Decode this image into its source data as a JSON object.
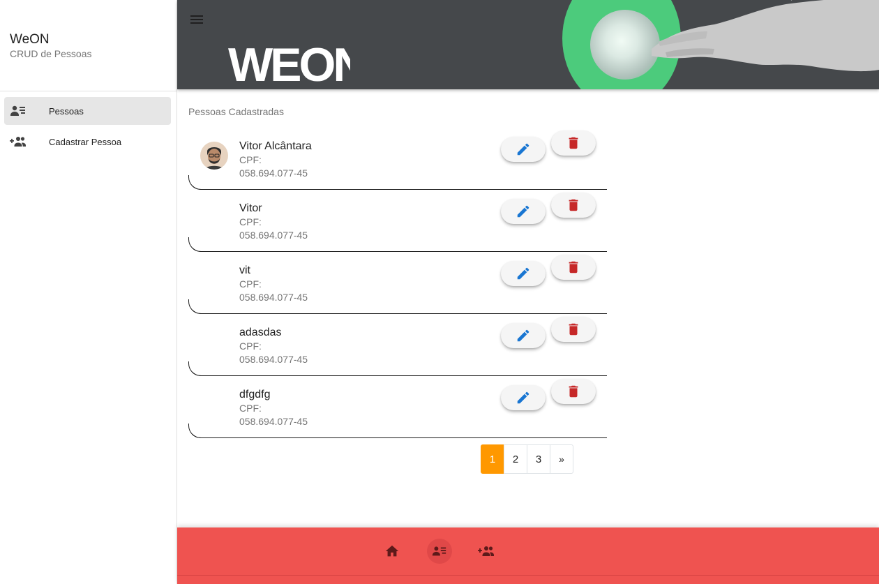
{
  "sidebar": {
    "title": "WeON",
    "subtitle": "CRUD de Pessoas",
    "items": [
      {
        "label": "Pessoas",
        "icon": "person-list-icon",
        "active": true
      },
      {
        "label": "Cadastrar Pessoa",
        "icon": "add-group-icon",
        "active": false
      }
    ]
  },
  "header": {
    "menu_icon": "hamburger-menu-icon",
    "logo_text": "WEON",
    "accent_color": "#4ccb7c"
  },
  "main": {
    "section_title": "Pessoas Cadastradas",
    "people": [
      {
        "name": "Vitor Alcântara",
        "cpf_label": "CPF:",
        "cpf": "058.694.077-45",
        "has_avatar": true
      },
      {
        "name": "Vitor",
        "cpf_label": "CPF:",
        "cpf": "058.694.077-45",
        "has_avatar": false
      },
      {
        "name": "vit",
        "cpf_label": "CPF:",
        "cpf": "058.694.077-45",
        "has_avatar": false
      },
      {
        "name": "adasdas",
        "cpf_label": "CPF:",
        "cpf": "058.694.077-45",
        "has_avatar": false
      },
      {
        "name": "dfgdfg",
        "cpf_label": "CPF:",
        "cpf": "058.694.077-45",
        "has_avatar": false
      }
    ],
    "edit_icon": "pencil-icon",
    "delete_icon": "trash-icon",
    "edit_color": "#1976d2",
    "delete_color": "#c62828"
  },
  "pagination": {
    "pages": [
      "1",
      "2",
      "3",
      "»"
    ],
    "active_page": "1",
    "active_color": "#ff9800"
  },
  "footer": {
    "color": "#ef5350",
    "buttons": [
      {
        "icon": "home-icon",
        "active": false
      },
      {
        "icon": "person-list-icon",
        "active": true
      },
      {
        "icon": "add-group-icon",
        "active": false
      }
    ]
  }
}
